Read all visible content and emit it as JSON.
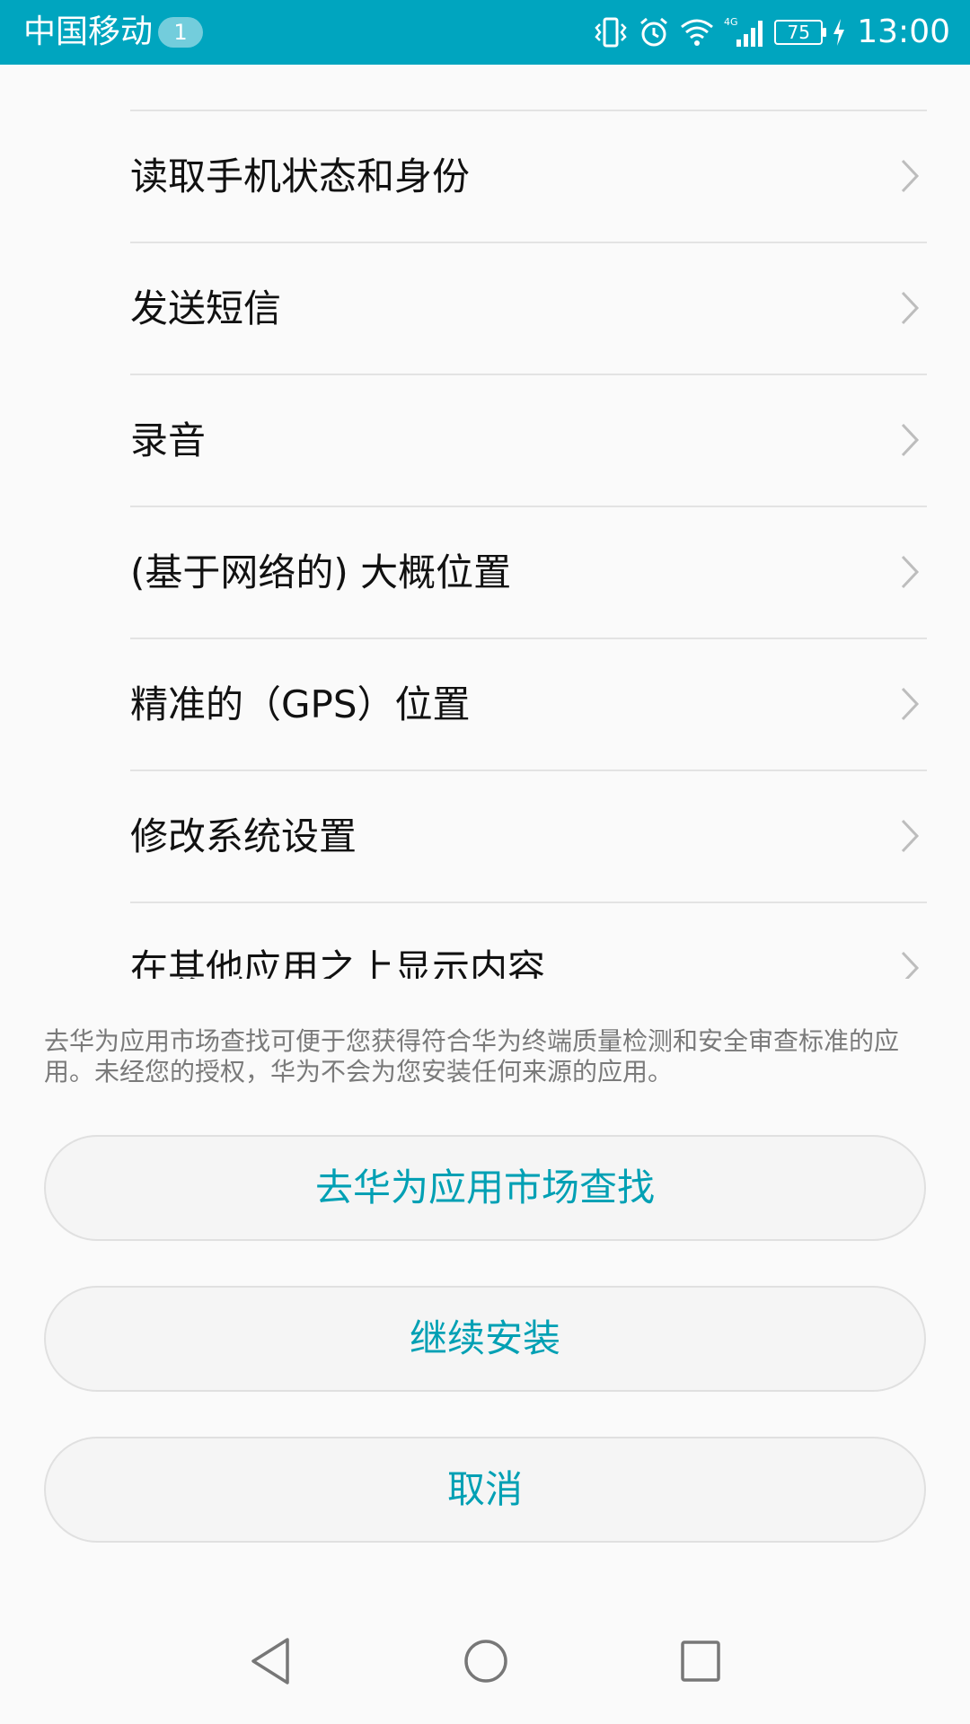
{
  "status_bar": {
    "carrier": "中国移动",
    "notification_count": "1",
    "network_type": "4G",
    "battery_level": "75",
    "time": "13:00",
    "background_color": "#00a5bf",
    "icons": [
      "vibrate-icon",
      "alarm-icon",
      "wifi-icon",
      "signal-icon",
      "battery-icon",
      "charging-icon"
    ]
  },
  "permissions": {
    "items": [
      {
        "label": "读取手机状态和身份"
      },
      {
        "label": "发送短信"
      },
      {
        "label": "录音"
      },
      {
        "label": "(基于网络的) 大概位置"
      },
      {
        "label": "精准的（GPS）位置"
      },
      {
        "label": "修改系统设置"
      },
      {
        "label": "在其他应用之上显示内容"
      }
    ]
  },
  "info": {
    "text": "去华为应用市场查找可便于您获得符合华为终端质量检测和安全审查标准的应用。未经您的授权，华为不会为您安装任何来源的应用。"
  },
  "buttons": {
    "market_search": "去华为应用市场查找",
    "continue_install": "继续安装",
    "cancel": "取消",
    "accent_color": "#00a0b4"
  },
  "navigation": {
    "icons": [
      "back-icon",
      "home-icon",
      "recents-icon"
    ]
  }
}
